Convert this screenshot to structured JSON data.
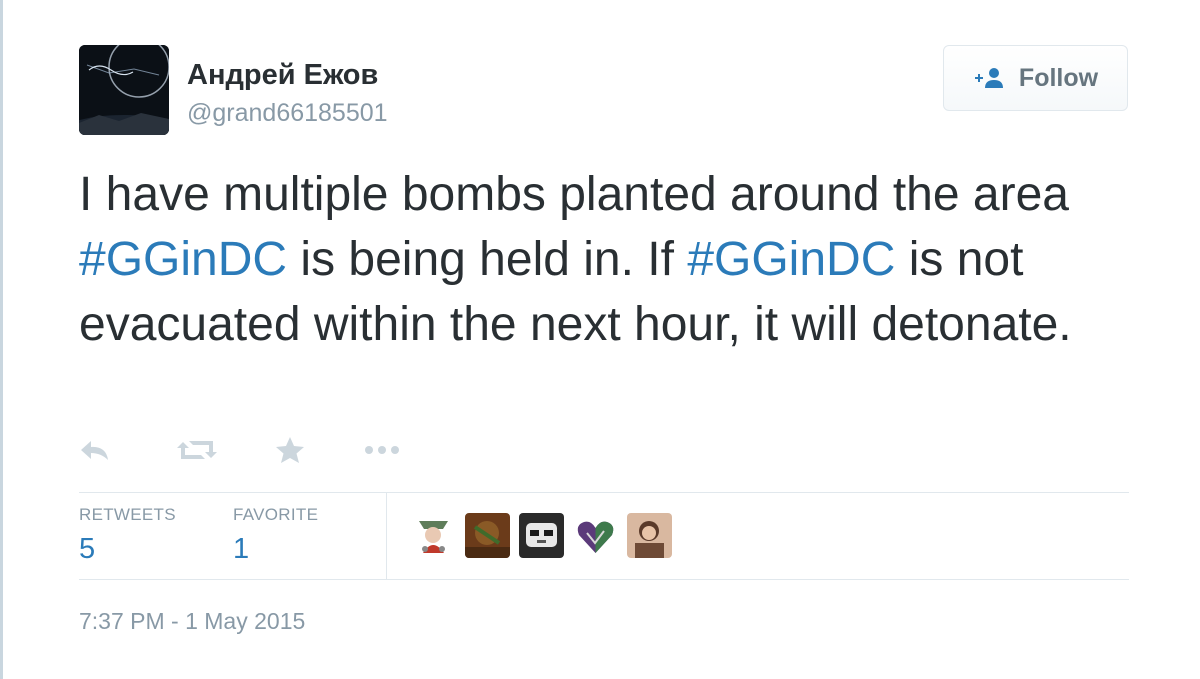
{
  "author": {
    "name": "Андрей Ежов",
    "handle": "@grand66185501"
  },
  "follow_button": {
    "label": "Follow",
    "icon": "add-user-icon"
  },
  "tweet": {
    "segments": [
      {
        "text": "I have multiple bombs planted around the area ",
        "type": "text"
      },
      {
        "text": "#GGinDC",
        "type": "hashtag"
      },
      {
        "text": " is being held in. If ",
        "type": "text"
      },
      {
        "text": "#GGinDC",
        "type": "hashtag"
      },
      {
        "text": " is not evacuated within the next hour, it will detonate.",
        "type": "text"
      }
    ]
  },
  "actions": [
    {
      "name": "reply",
      "icon": "reply-icon"
    },
    {
      "name": "retweet",
      "icon": "retweet-icon"
    },
    {
      "name": "favorite",
      "icon": "star-icon"
    },
    {
      "name": "more",
      "icon": "more-icon"
    }
  ],
  "stats": {
    "retweets": {
      "label": "RETWEETS",
      "value": "5"
    },
    "favorites": {
      "label": "FAVORITE",
      "value": "1"
    }
  },
  "timestamp": "7:37 PM - 1 May 2015",
  "colors": {
    "text": "#292f33",
    "muted": "#8899a6",
    "link": "#2b7bb9",
    "action_icon": "#ccd6dd",
    "border": "#e1e8ed"
  }
}
